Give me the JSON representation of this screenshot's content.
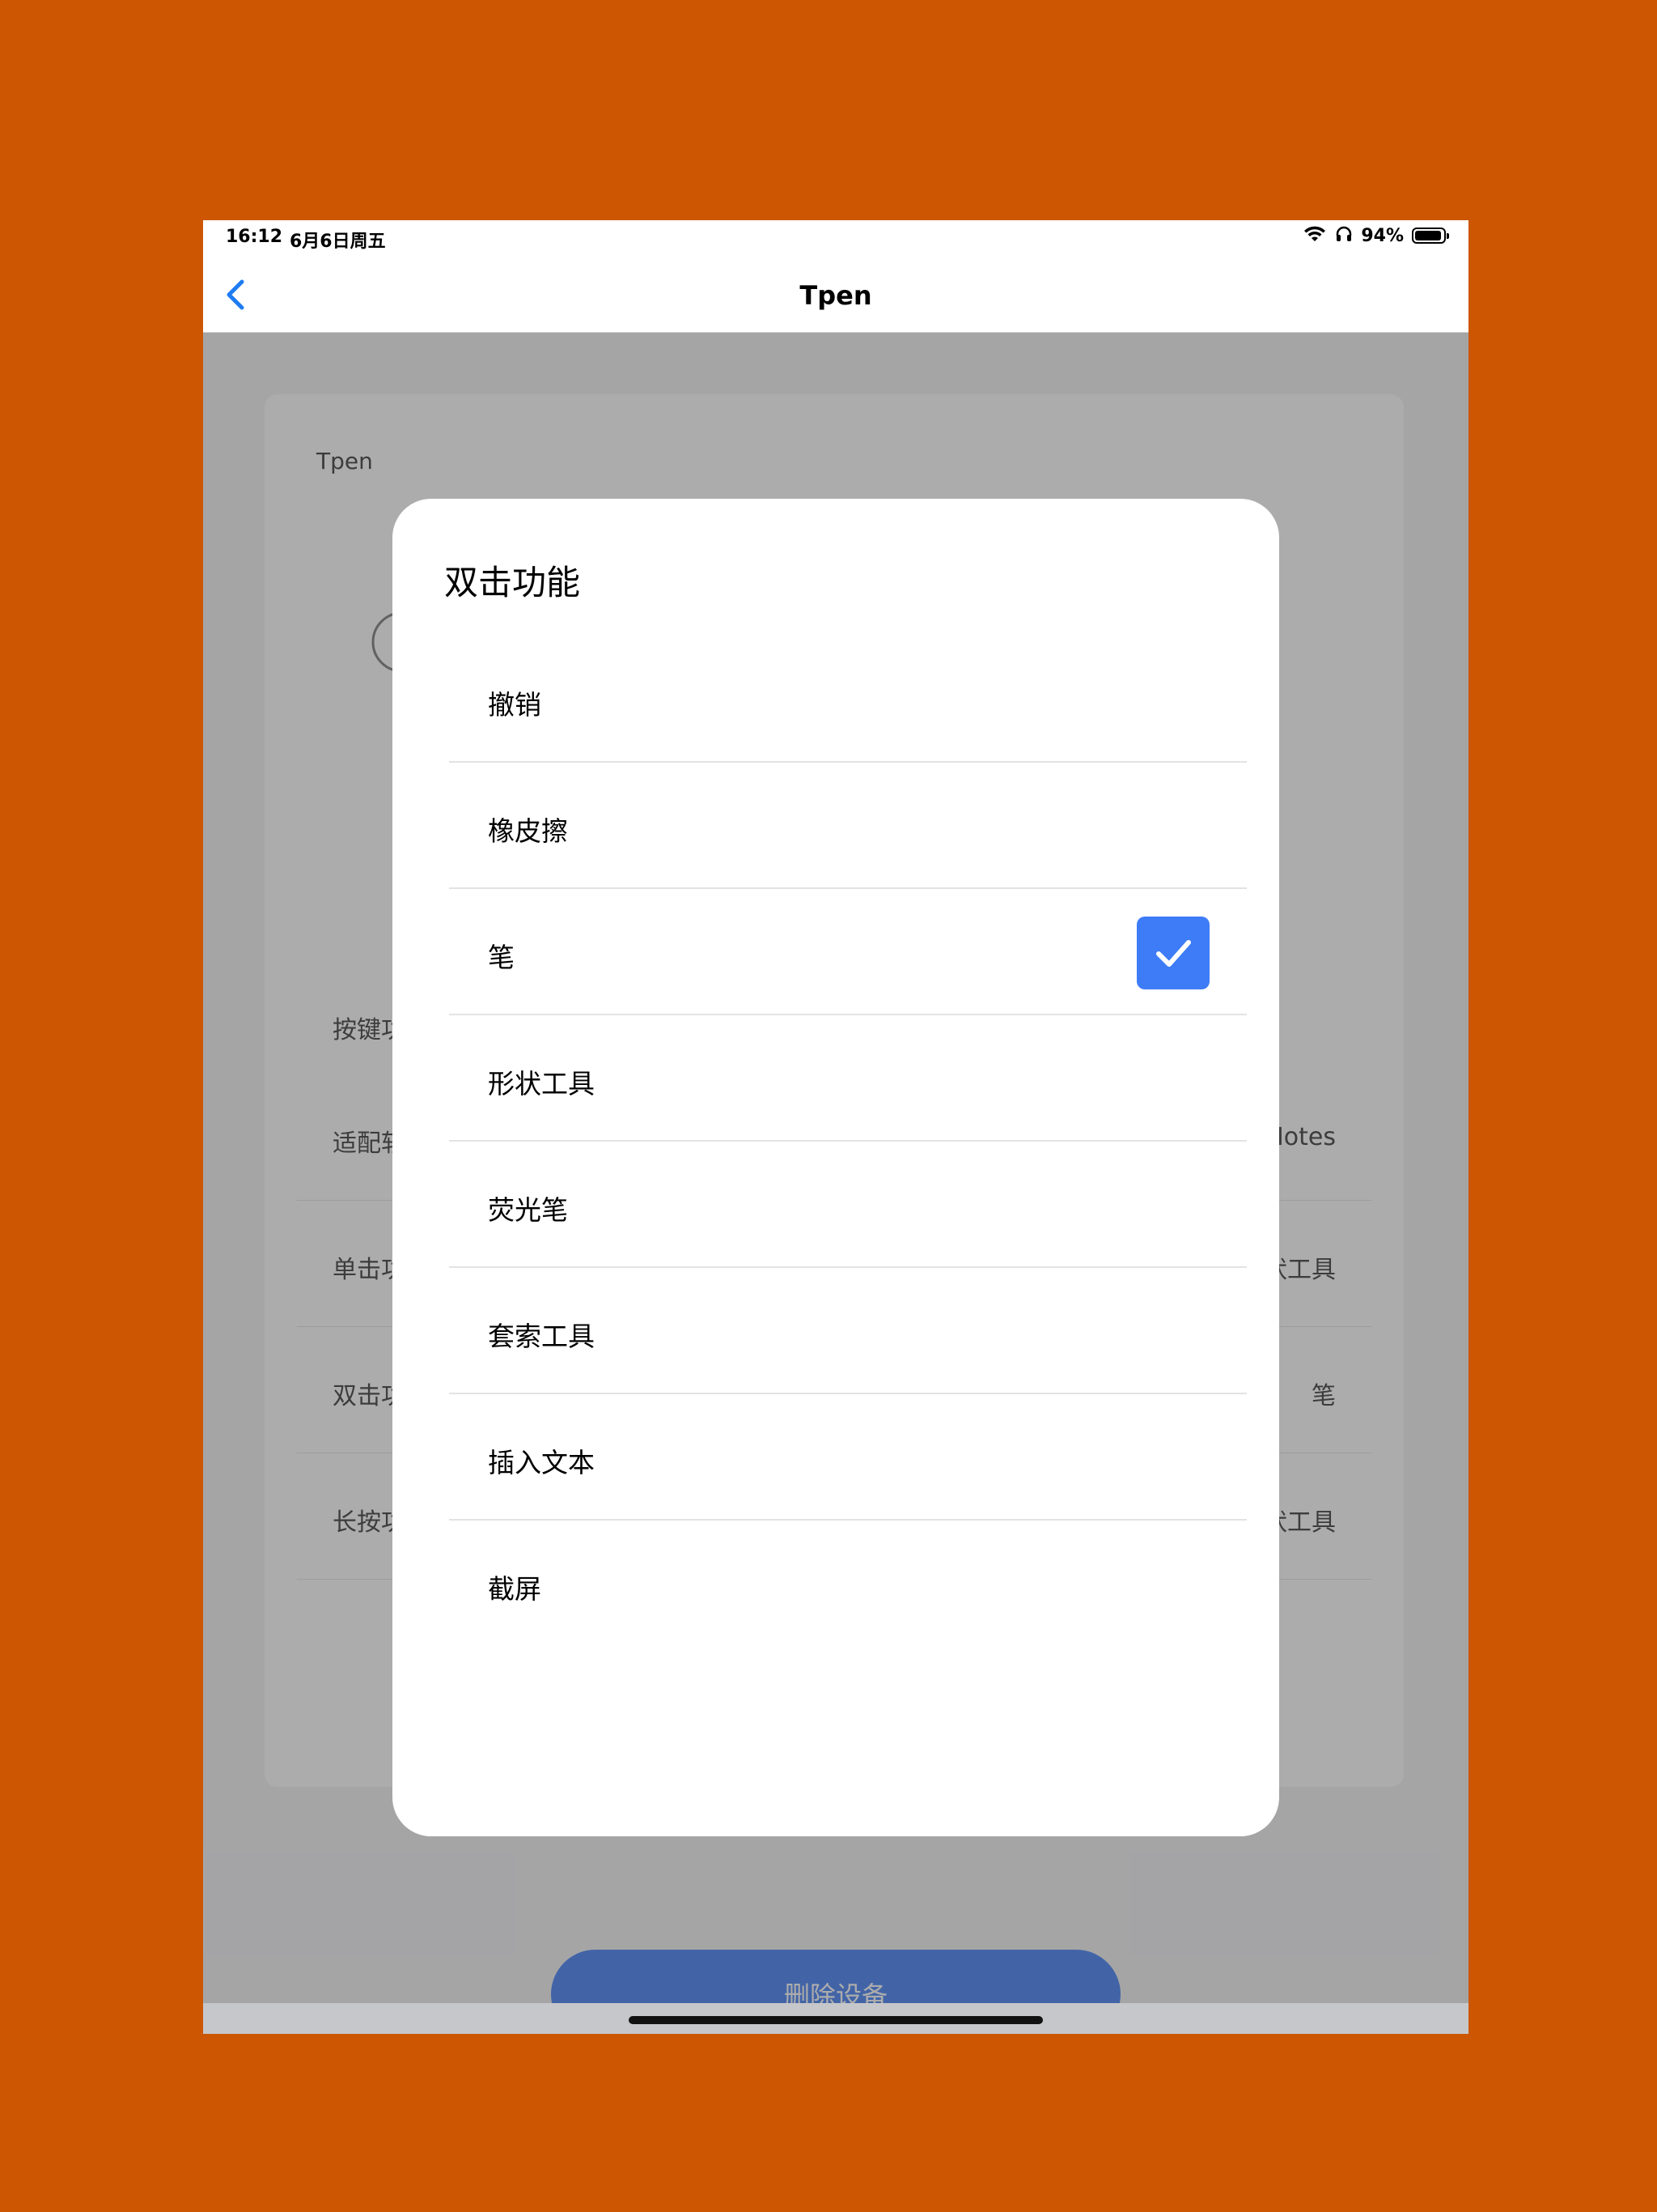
{
  "status_bar": {
    "time": "16:12",
    "date": "6月6日周五",
    "battery": "94%"
  },
  "nav": {
    "title": "Tpen"
  },
  "background": {
    "device_name": "Tpen",
    "section_label": "按键功能",
    "rows": [
      {
        "label": "适配软件",
        "value": "Notes"
      },
      {
        "label": "单击功能",
        "value": "形状工具"
      },
      {
        "label": "双击功能",
        "value": "笔"
      },
      {
        "label": "长按功能",
        "value": "形状工具"
      }
    ],
    "delete_label": "删除设备"
  },
  "modal": {
    "title": "双击功能",
    "options": [
      {
        "label": "撤销",
        "selected": false
      },
      {
        "label": "橡皮擦",
        "selected": false
      },
      {
        "label": "笔",
        "selected": true
      },
      {
        "label": "形状工具",
        "selected": false
      },
      {
        "label": "荧光笔",
        "selected": false
      },
      {
        "label": "套索工具",
        "selected": false
      },
      {
        "label": "插入文本",
        "selected": false
      },
      {
        "label": "截屏",
        "selected": false
      }
    ]
  },
  "colors": {
    "accent": "#3d7cf6",
    "page_bg": "#cc5602",
    "back_arrow": "#1e7cf2"
  }
}
